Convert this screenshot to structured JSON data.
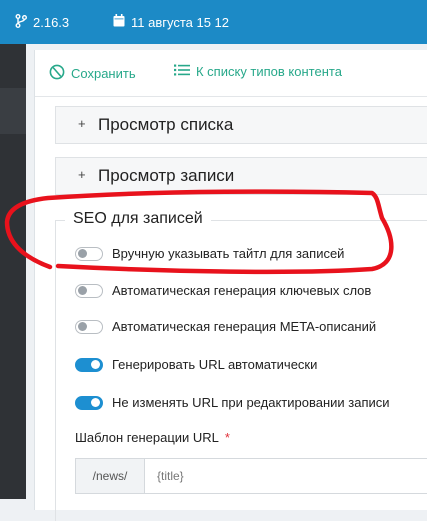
{
  "topbar": {
    "version": "2.16.3",
    "date": "11 августа 15 12"
  },
  "toolbar": {
    "save_label": "Сохранить",
    "list_label": "К списку типов контента"
  },
  "accordions": [
    {
      "icon": "+",
      "label": "Просмотр списка"
    },
    {
      "icon": "+",
      "label": "Просмотр записи"
    }
  ],
  "seo": {
    "legend": "SEO для записей",
    "options": [
      {
        "label": "Вручную указывать тайтл для записей",
        "checked": false
      },
      {
        "label": "Автоматическая генерация ключевых слов",
        "checked": false
      },
      {
        "label": "Автоматическая генерация META-описаний",
        "checked": false
      },
      {
        "label": "Генерировать URL автоматически",
        "checked": true
      },
      {
        "label": "Не изменять URL при редактировании записи",
        "checked": true
      }
    ],
    "template_label": "Шаблон генерации URL",
    "required_mark": "*",
    "template_prefix": "/news/",
    "template_value": "{title}"
  },
  "colors": {
    "topbar": "#1c8ac6",
    "accent_green": "#27a88a",
    "toggle_on": "#1d8fd1",
    "annotation": "#e8121c"
  }
}
